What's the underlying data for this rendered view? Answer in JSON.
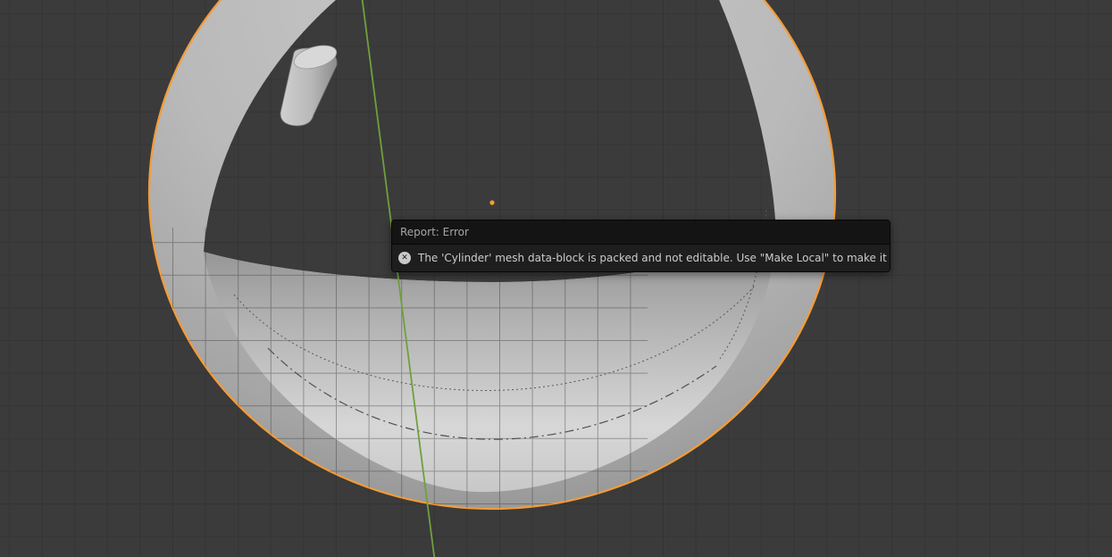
{
  "viewport": {
    "background_color": "#3b3b3b",
    "grid_line_color": "#343434",
    "selection_outline_color": "#f59c38",
    "y_axis_color": "#6fa03d",
    "origin_dot_color": "#f5a12a",
    "selected_object": "torus-mesh",
    "other_object": "cylinder-mesh"
  },
  "report": {
    "title": "Report: Error",
    "message": "The 'Cylinder' mesh data-block is packed and not editable. Use \"Make Local\" to make it editable.",
    "icon": "error-cross-icon",
    "header_background": "#141414",
    "body_background": "#1e1e1e"
  }
}
